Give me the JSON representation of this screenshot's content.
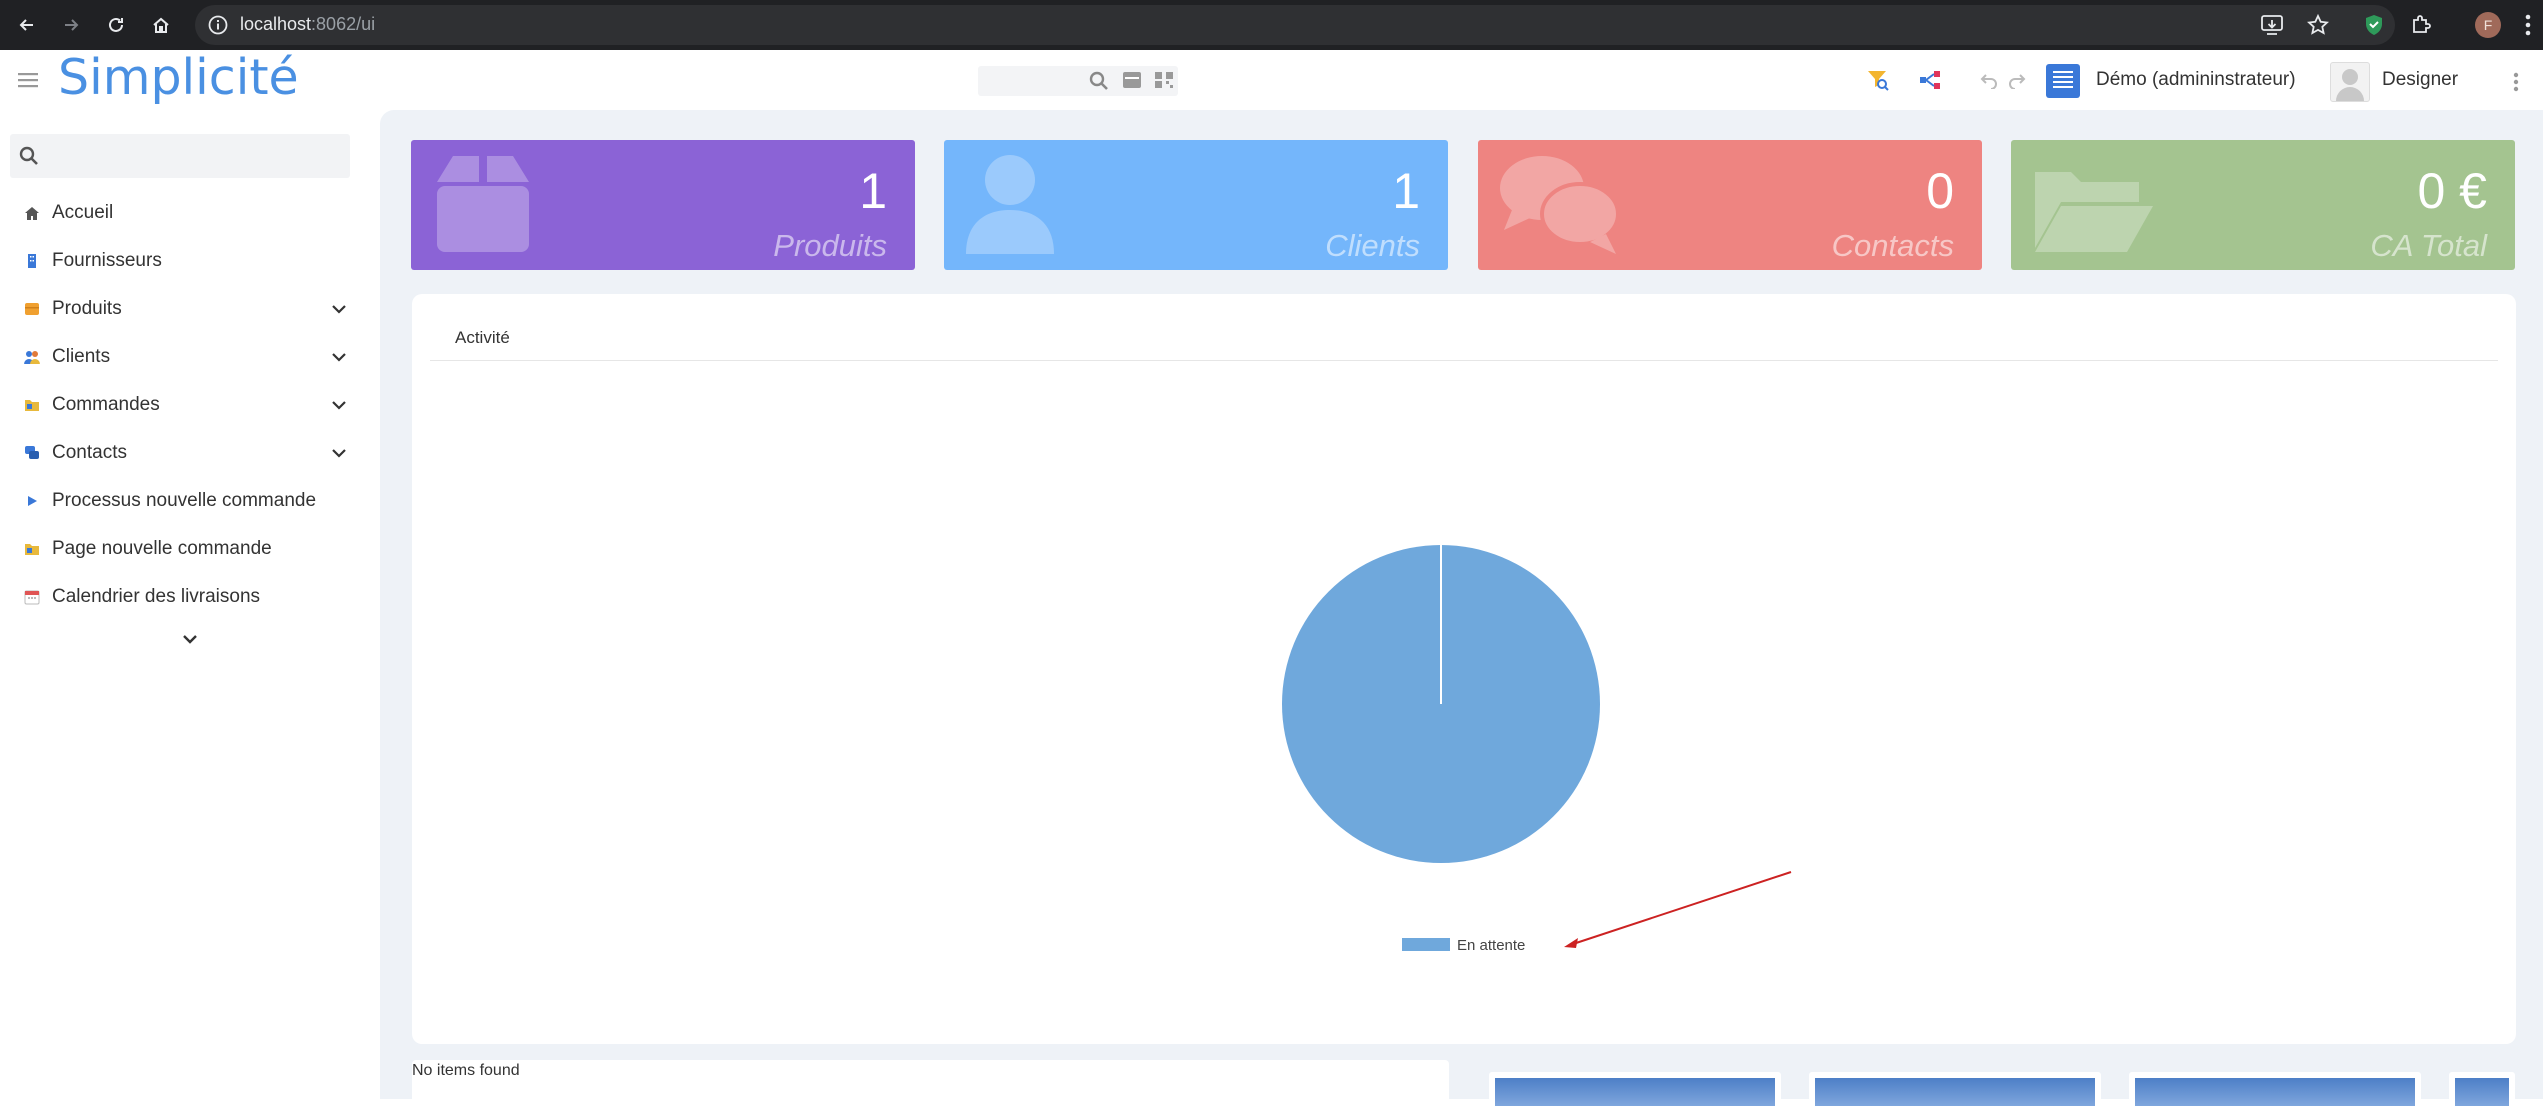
{
  "browser": {
    "url_host": "localhost",
    "url_path": ":8062/ui",
    "profile_initial": "F"
  },
  "header": {
    "logo": "Simplicité",
    "user_label": "Démo (admininstrateur)",
    "designer_label": "Designer"
  },
  "sidebar": {
    "search_placeholder": "",
    "items": [
      {
        "label": "Accueil",
        "icon": "home-icon",
        "color": "#555555",
        "expandable": false
      },
      {
        "label": "Fournisseurs",
        "icon": "building-icon",
        "color": "#3a78d8",
        "expandable": false
      },
      {
        "label": "Produits",
        "icon": "box-icon",
        "color": "#f0a030",
        "expandable": true
      },
      {
        "label": "Clients",
        "icon": "people-icon",
        "color": "#e07a3a",
        "expandable": true
      },
      {
        "label": "Commandes",
        "icon": "folder-icon",
        "color": "#e8b93c",
        "expandable": true
      },
      {
        "label": "Contacts",
        "icon": "chat-icon",
        "color": "#3a78d8",
        "expandable": true
      },
      {
        "label": "Processus nouvelle commande",
        "icon": "play-icon",
        "color": "#3a78d8",
        "expandable": false
      },
      {
        "label": "Page nouvelle commande",
        "icon": "folder-icon",
        "color": "#e8b93c",
        "expandable": false
      },
      {
        "label": "Calendrier des livraisons",
        "icon": "calendar-icon",
        "color": "#e05555",
        "expandable": false
      }
    ]
  },
  "tiles": [
    {
      "value": "1",
      "label": "Produits",
      "color": "#8b63d6",
      "icon": "box-icon"
    },
    {
      "value": "1",
      "label": "Clients",
      "color": "#74b6fb",
      "icon": "user-icon"
    },
    {
      "value": "0",
      "label": "Contacts",
      "color": "#ee8481",
      "icon": "chat-icon"
    },
    {
      "value": "0 €",
      "label": "CA Total",
      "color": "#a4c490",
      "icon": "folder-icon"
    }
  ],
  "activity": {
    "title": "Activité"
  },
  "chart_data": {
    "type": "pie",
    "categories": [
      "En attente"
    ],
    "values": [
      1
    ],
    "colors": [
      "#6fa8dc"
    ],
    "legend": "bottom"
  },
  "list": {
    "empty_text": "No items found"
  },
  "colors": {
    "brand": "#4a90e2",
    "main_bg": "#eef2f7",
    "annotation_arrow": "#cc2222"
  }
}
